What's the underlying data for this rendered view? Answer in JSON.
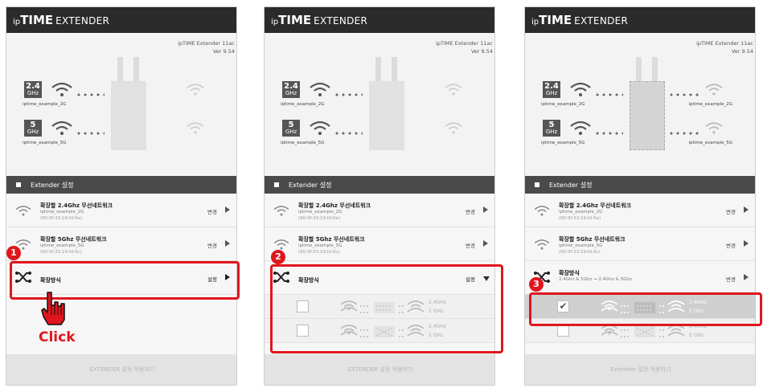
{
  "app": {
    "logo_prefix": "ip",
    "logo_main": "TIME",
    "logo_suffix": "EXTENDER"
  },
  "version": {
    "model": "ipTIME Extender 11ac",
    "ver": "Ver 9.54"
  },
  "bands": {
    "b24": {
      "num": "2.4",
      "unit": "GHz",
      "ssid": "iptime_example_2G"
    },
    "b5": {
      "num": "5",
      "unit": "GHz",
      "ssid": "iptime_example_5G"
    }
  },
  "section_title": "Extender 설정",
  "rows": [
    {
      "title": "확장할 2.4Ghz 무선네트워크",
      "ssid": "iptime_example_2G",
      "mac": "(90:9f:33:19:fd:6e)",
      "action": "변경"
    },
    {
      "title": "확장할 5Ghz 무선네트워크",
      "ssid": "iptime_example_5G",
      "mac": "(90:9f:33:19:fd:6c)",
      "action": "변경"
    }
  ],
  "mode": {
    "title": "확장방식",
    "action_set": "설정",
    "action_change": "변경",
    "summary": "2.4Ghz & 5Ghz → 2.4Ghz & 5Ghz"
  },
  "options": {
    "label_24": "2.4GHz",
    "label_5": "5 GHz"
  },
  "buttons": {
    "apply_1": "EXTENDER 설정 적용하기",
    "apply_2": "EXTENDER 설정 적용하기",
    "apply_3": "Extender 설정 적용하기"
  },
  "annotations": {
    "click": "Click",
    "step1": "1",
    "step2": "2",
    "step3": "3"
  },
  "colors": {
    "accent_red": "#e0161e",
    "appbar": "#2b2b2b",
    "section": "#4a4a4a"
  }
}
